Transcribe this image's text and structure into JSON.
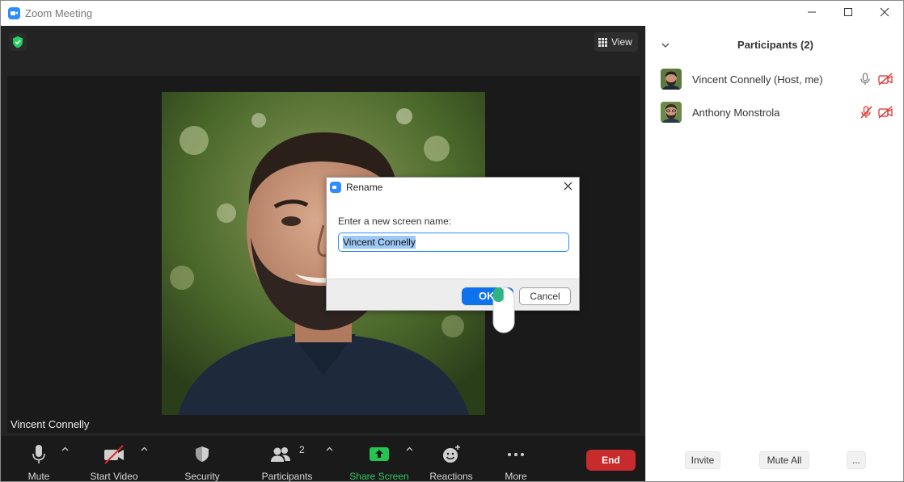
{
  "window": {
    "title": "Zoom Meeting",
    "controls": [
      "minimize",
      "maximize",
      "close"
    ]
  },
  "meeting": {
    "view_label": "View",
    "speaker_name": "Vincent Connelly",
    "encryption_badge": "shield-check-icon"
  },
  "toolbar": {
    "mute": "Mute",
    "start_video": "Start Video",
    "security": "Security",
    "participants": "Participants",
    "participants_count": "2",
    "share_screen": "Share Screen",
    "reactions": "Reactions",
    "more": "More",
    "end": "End"
  },
  "participants_panel": {
    "title": "Participants (2)",
    "rows": [
      {
        "name": "Vincent Connelly (Host, me)",
        "audio": "mic-on",
        "video": "video-off"
      },
      {
        "name": "Anthony Monstrola",
        "audio": "mic-muted",
        "video": "video-off"
      }
    ],
    "invite": "Invite",
    "mute_all": "Mute All",
    "more": "..."
  },
  "rename_dialog": {
    "title": "Rename",
    "prompt": "Enter a new screen name:",
    "input_value": "Vincent Connelly",
    "ok": "OK",
    "cancel": "Cancel"
  },
  "colors": {
    "zoom_blue": "#2d8cff",
    "ok_blue": "#0e72ed",
    "end_red": "#c72b2b",
    "share_green": "#2dcb5f",
    "muted_red": "#e02828",
    "meeting_bg": "#232323"
  }
}
